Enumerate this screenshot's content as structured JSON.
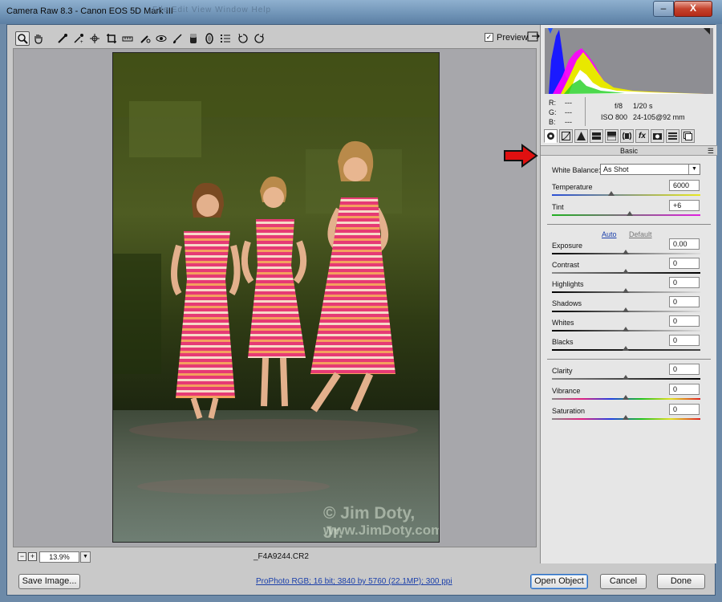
{
  "window": {
    "title": "Camera Raw 8.3  -  Canon EOS 5D Mark III",
    "ghost_menu": "File   Edit   View   Window   Help",
    "minimize_label": "–",
    "close_label": "X"
  },
  "toolbar": {
    "tools": [
      "zoom-tool",
      "hand-tool",
      "white-balance-tool",
      "color-sampler-tool",
      "targeted-adjustment-tool",
      "crop-tool",
      "straighten-tool",
      "spot-removal-tool",
      "red-eye-tool",
      "adjustment-brush-tool",
      "graduated-filter-tool",
      "radial-filter-tool",
      "preferences-tool",
      "rotate-ccw-tool",
      "rotate-cw-tool"
    ],
    "preview_label": "Preview",
    "preview_checked": "✓"
  },
  "status": {
    "zoom": "13.9%",
    "filename": "_F4A9244.CR2"
  },
  "photo": {
    "watermark_line1": "© Jim Doty, Jr.",
    "watermark_line2": "www.JimDoty.com"
  },
  "bottom": {
    "save_label": "Save Image...",
    "workflow_link": "ProPhoto RGB; 16 bit; 3840 by 5760 (22.1MP); 300 ppi",
    "open_label": "Open Object",
    "cancel_label": "Cancel",
    "done_label": "Done"
  },
  "readout": {
    "r_label": "R:",
    "g_label": "G:",
    "b_label": "B:",
    "r_value": "---",
    "g_value": "---",
    "b_value": "---",
    "aperture": "f/8",
    "shutter": "1/20 s",
    "iso": "ISO 800",
    "lens": "24-105@92 mm"
  },
  "tabs": [
    "basic",
    "tone-curve",
    "detail",
    "hsl",
    "split-toning",
    "lens-corrections",
    "effects",
    "camera-calibration",
    "presets",
    "snapshots"
  ],
  "basic": {
    "section_title": "Basic",
    "white_balance_label": "White Balance:",
    "white_balance_value": "As Shot",
    "temperature_label": "Temperature",
    "temperature_value": "6000",
    "tint_label": "Tint",
    "tint_value": "+6",
    "auto_label": "Auto",
    "default_label": "Default",
    "exposure_label": "Exposure",
    "exposure_value": "0.00",
    "contrast_label": "Contrast",
    "contrast_value": "0",
    "highlights_label": "Highlights",
    "highlights_value": "0",
    "shadows_label": "Shadows",
    "shadows_value": "0",
    "whites_label": "Whites",
    "whites_value": "0",
    "blacks_label": "Blacks",
    "blacks_value": "0",
    "clarity_label": "Clarity",
    "clarity_value": "0",
    "vibrance_label": "Vibrance",
    "vibrance_value": "0",
    "saturation_label": "Saturation",
    "saturation_value": "0"
  },
  "colors": {
    "accent_link": "#1a3faa",
    "annotation_arrow": "#e01010"
  }
}
